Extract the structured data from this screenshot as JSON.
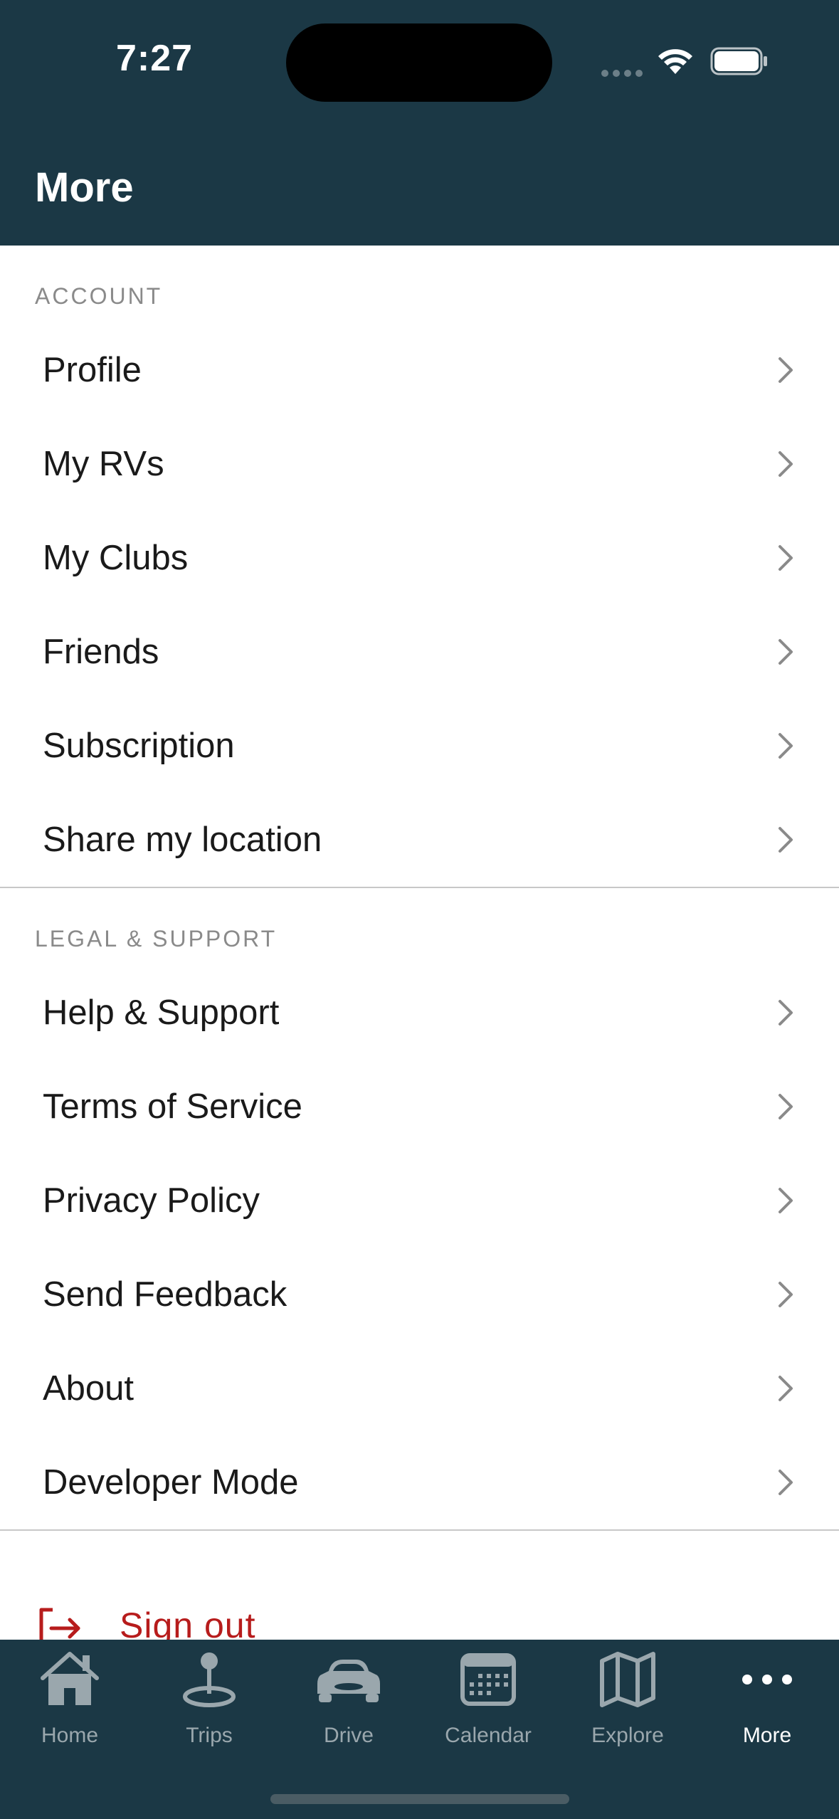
{
  "status": {
    "time": "7:27"
  },
  "header": {
    "title": "More"
  },
  "sections": {
    "account": {
      "title": "ACCOUNT",
      "items": [
        "Profile",
        "My RVs",
        "My Clubs",
        "Friends",
        "Subscription",
        "Share my location"
      ]
    },
    "legal": {
      "title": "LEGAL & SUPPORT",
      "items": [
        "Help & Support",
        "Terms of Service",
        "Privacy Policy",
        "Send Feedback",
        "About",
        "Developer Mode"
      ]
    }
  },
  "signout": {
    "label": "Sign out",
    "color": "#b71c1c"
  },
  "tabs": [
    {
      "label": "Home",
      "icon": "home-icon"
    },
    {
      "label": "Trips",
      "icon": "pin-icon"
    },
    {
      "label": "Drive",
      "icon": "car-icon"
    },
    {
      "label": "Calendar",
      "icon": "calendar-icon"
    },
    {
      "label": "Explore",
      "icon": "map-icon"
    },
    {
      "label": "More",
      "icon": "more-icon",
      "active": true
    }
  ],
  "colors": {
    "bar": "#1b3845",
    "active_tab": "#ffffff",
    "inactive_tab": "#9aa7ad"
  }
}
